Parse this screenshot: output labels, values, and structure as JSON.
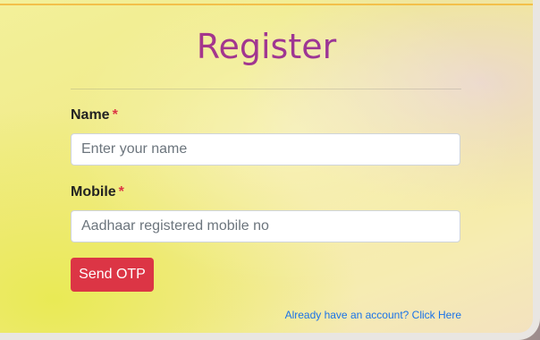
{
  "form": {
    "title": "Register",
    "name_label": "Name",
    "name_required": "*",
    "name_placeholder": "Enter your name",
    "name_value": "",
    "mobile_label": "Mobile",
    "mobile_required": "*",
    "mobile_placeholder": "Aadhaar registered mobile no",
    "mobile_value": "",
    "send_otp_label": "Send OTP",
    "login_link_text": "Already have an account? Click Here"
  },
  "colors": {
    "title_gradient_start": "#b3367c",
    "title_gradient_end": "#8d35a6",
    "button_bg": "#dc3545",
    "required_star": "#dc3545",
    "link": "#1a73e8",
    "top_accent": "#f3c04a"
  }
}
